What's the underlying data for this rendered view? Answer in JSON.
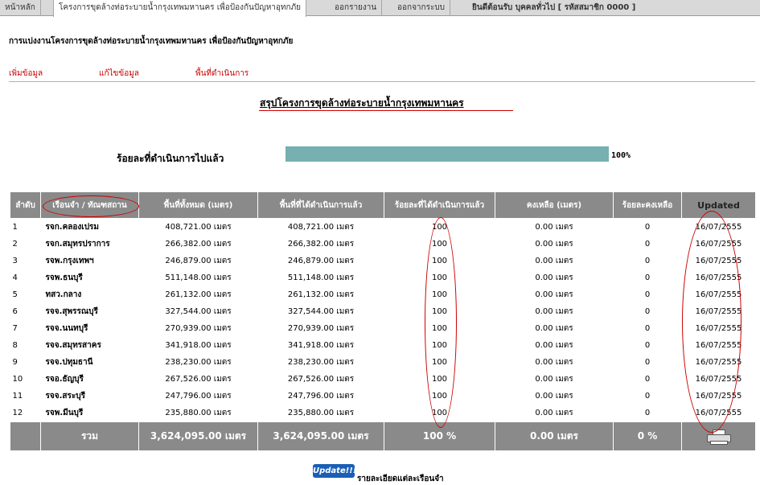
{
  "tabs": [
    {
      "label": "หน้าหลัก",
      "active": false
    },
    {
      "label": "โครงการขุดล้างท่อระบายน้ำกรุงเทพมหานคร เพื่อป้องกันปัญหาอุทกภัย",
      "active": true
    },
    {
      "label": "ออกรายงาน",
      "active": false
    },
    {
      "label": "ออกจากระบบ",
      "active": false
    }
  ],
  "welcome": "ยินดีต้อนรับ บุคคลทั่วไป [ รหัสสมาชิก 0000 ]",
  "subtitle": "การแบ่งงานโครงการขุดล้างท่อระบายน้ำกรุงเทพมหานคร เพื่อป้องกันปัญหาอุทกภัย",
  "menu": {
    "add": "เพิ่มข้อมูล",
    "edit": "แก้ไขข้อมูล",
    "area": "พื้นที่ดำเนินการ"
  },
  "report_title": "สรุปโครงการขุดล้างท่อระบายน้ำกรุงเทพมหานคร",
  "progress": {
    "label": "ร้อยละที่ดำเนินการไปแล้ว",
    "value": 100,
    "text": "100%"
  },
  "table": {
    "headers": [
      "ลำดับ",
      "เรือนจำ / ทัณฑสถาน",
      "พื้นที่ทั้งหมด (เมตร)",
      "พื้นที่ที่ได้ดำเนินการแล้ว",
      "ร้อยละที่ได้ดำเนินการแล้ว",
      "คงเหลือ (เมตร)",
      "ร้อยละคงเหลือ",
      "Updated"
    ],
    "rows": [
      [
        "1",
        "รจก.คลองเปรม",
        "408,721.00 เมตร",
        "408,721.00 เมตร",
        "100",
        "0.00 เมตร",
        "0",
        "16/07/2555"
      ],
      [
        "2",
        "รจก.สมุทรปราการ",
        "266,382.00 เมตร",
        "266,382.00 เมตร",
        "100",
        "0.00 เมตร",
        "0",
        "16/07/2555"
      ],
      [
        "3",
        "รจพ.กรุงเทพฯ",
        "246,879.00 เมตร",
        "246,879.00 เมตร",
        "100",
        "0.00 เมตร",
        "0",
        "16/07/2555"
      ],
      [
        "4",
        "รจพ.ธนบุรี",
        "511,148.00 เมตร",
        "511,148.00 เมตร",
        "100",
        "0.00 เมตร",
        "0",
        "16/07/2555"
      ],
      [
        "5",
        "ทสว.กลาง",
        "261,132.00 เมตร",
        "261,132.00 เมตร",
        "100",
        "0.00 เมตร",
        "0",
        "16/07/2555"
      ],
      [
        "6",
        "รจจ.สุพรรณบุรี",
        "327,544.00 เมตร",
        "327,544.00 เมตร",
        "100",
        "0.00 เมตร",
        "0",
        "16/07/2555"
      ],
      [
        "7",
        "รจจ.นนทบุรี",
        "270,939.00 เมตร",
        "270,939.00 เมตร",
        "100",
        "0.00 เมตร",
        "0",
        "16/07/2555"
      ],
      [
        "8",
        "รจจ.สมุทรสาคร",
        "341,918.00 เมตร",
        "341,918.00 เมตร",
        "100",
        "0.00 เมตร",
        "0",
        "16/07/2555"
      ],
      [
        "9",
        "รจจ.ปทุมธานี",
        "238,230.00 เมตร",
        "238,230.00 เมตร",
        "100",
        "0.00 เมตร",
        "0",
        "16/07/2555"
      ],
      [
        "10",
        "รจอ.ธัญบุรี",
        "267,526.00 เมตร",
        "267,526.00 เมตร",
        "100",
        "0.00 เมตร",
        "0",
        "16/07/2555"
      ],
      [
        "11",
        "รจจ.สระบุรี",
        "247,796.00 เมตร",
        "247,796.00 เมตร",
        "100",
        "0.00 เมตร",
        "0",
        "16/07/2555"
      ],
      [
        "12",
        "รจพ.มีนบุรี",
        "235,880.00 เมตร",
        "235,880.00 เมตร",
        "100",
        "0.00 เมตร",
        "0",
        "16/07/2555"
      ]
    ],
    "total": {
      "label": "รวม",
      "total_area": "3,624,095.00 เมตร",
      "done_area": "3,624,095.00 เมตร",
      "done_pct": "100 %",
      "remaining": "0.00 เมตร",
      "remaining_pct": "0 %",
      "print_icon": "printer-icon"
    }
  },
  "footer": {
    "update_button": "Update!!!",
    "detail_text": "รายละเอียดแต่ละเรือนจำ"
  },
  "colors": {
    "header_bg": "#8a8a8a",
    "progress_fill": "#76b0b0",
    "link_red": "#cc0000",
    "annotation_red": "#cc0000"
  }
}
